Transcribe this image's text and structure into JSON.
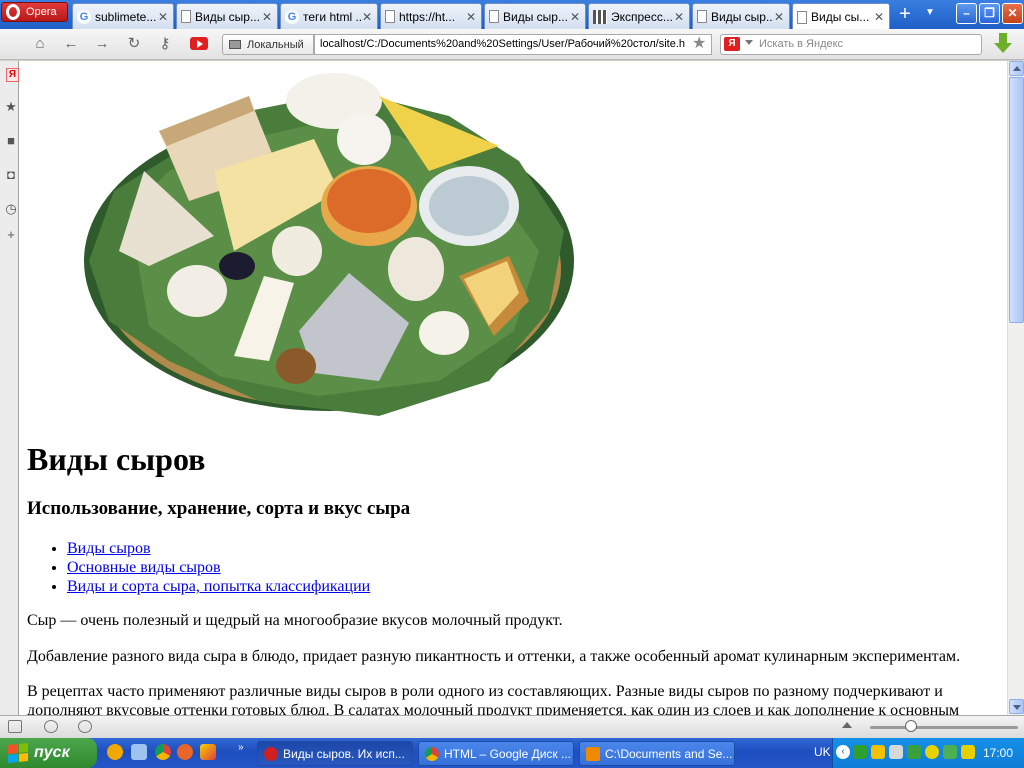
{
  "browser": {
    "opera_label": "Opera",
    "tabs": [
      {
        "title": "sublimete...",
        "icon": "google-icon"
      },
      {
        "title": "Виды сыр...",
        "icon": "document-icon"
      },
      {
        "title": "теги html ...",
        "icon": "google-icon"
      },
      {
        "title": "https://ht...",
        "icon": "document-icon"
      },
      {
        "title": "Виды сыр...",
        "icon": "document-icon"
      },
      {
        "title": "Экспресс...",
        "icon": "speed-dial-icon"
      },
      {
        "title": "Виды сыр...",
        "icon": "document-icon"
      },
      {
        "title": "Виды сы...",
        "icon": "document-icon",
        "active": true
      }
    ],
    "new_tab": "+",
    "local_label": "Локальный",
    "url": "localhost/C:/Documents%20and%20Settings/User/Рабочий%20стол/site.h",
    "search_engine": "Я",
    "search_placeholder": "Искать в Яндекс"
  },
  "page": {
    "image_alt": "cheese platter",
    "heading": "Виды сыров",
    "subheading": "Использование, хранение, сорта и вкус сыра",
    "links": [
      "Виды сыров",
      "Основные виды сыров",
      "Виды и сорта сыра, попытка классификации"
    ],
    "paragraphs": [
      "Сыр — очень полезный и щедрый на многообразие вкусов молочный продукт.",
      "Добавление разного вида сыра в блюдо, придает разную пикантность и оттенки, а также особенный аромат кулинарным экспериментам.",
      "В рецептах часто применяют различные виды сыров в роли одного из составляющих. Разные виды сыров по разному подчеркивают и дополняют вкусовые оттенки готовых блюд. В салатах молочный продукт применяется, как один из слоев и как дополнение к основным"
    ]
  },
  "taskbar": {
    "start_label": "пуск",
    "tasks": [
      {
        "label": "Виды сыров. Их исп...",
        "icon_color": "#d02020",
        "active": true
      },
      {
        "label": "HTML – Google Диск ...",
        "icon_color": "#f2b600"
      },
      {
        "label": "C:\\Documents and Se...",
        "icon_color": "#f08a00"
      }
    ],
    "language": "UK",
    "time": "17:00"
  },
  "colors": {
    "link": "#0000ee",
    "xp_blue": "#2456c7",
    "start_green": "#3a963a"
  }
}
